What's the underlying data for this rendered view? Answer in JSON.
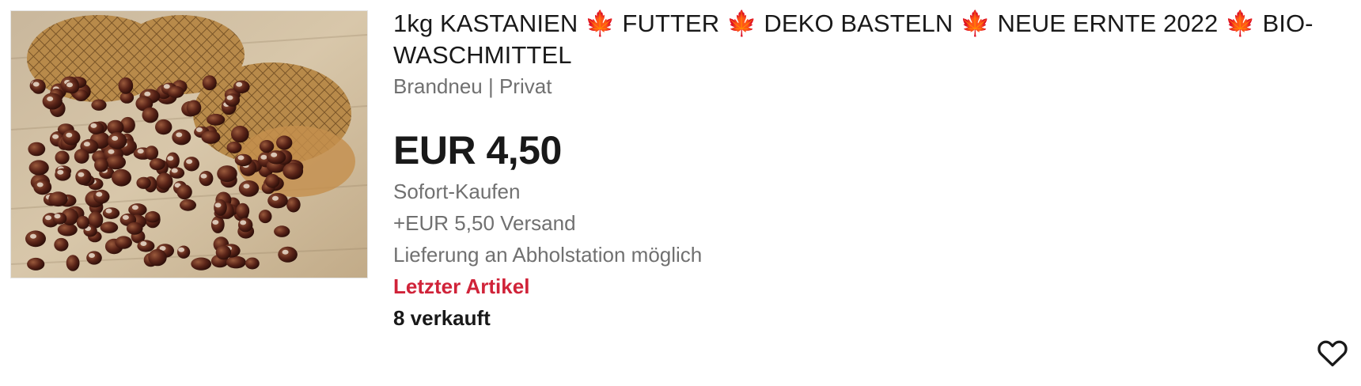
{
  "listing": {
    "title": "1kg KASTANIEN 🍁 FUTTER 🍁 DEKO BASTELN 🍁 NEUE ERNTE 2022 🍁 BIO-WASCHMITTEL",
    "subtitle": "Brandneu | Privat",
    "price": "EUR 4,50",
    "buy_format": "Sofort-Kaufen",
    "shipping": "+EUR 5,50 Versand",
    "delivery": "Lieferung an Abholstation möglich",
    "stock_note": "Letzter Artikel",
    "sold_count": "8 verkauft",
    "image_icon": "chestnuts-photo",
    "watch_icon": "heart-icon"
  },
  "colors": {
    "text": "#191919",
    "muted": "#707070",
    "alert": "#d02339"
  }
}
